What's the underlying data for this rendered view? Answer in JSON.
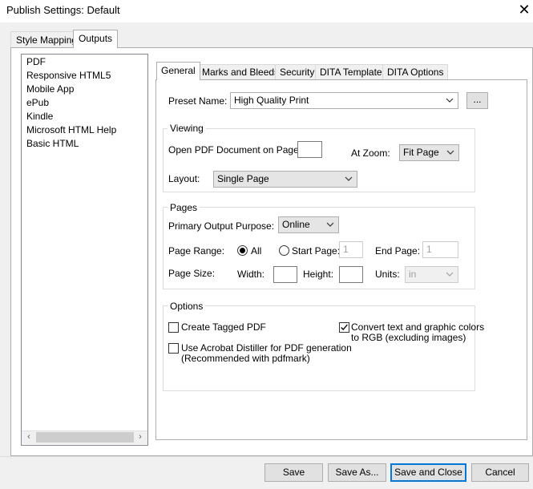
{
  "window": {
    "title": "Publish Settings: Default",
    "close_glyph": "✕"
  },
  "outer_tabs": [
    "Style Mapping",
    "Outputs"
  ],
  "outputs_list": [
    "PDF",
    "Responsive HTML5",
    "Mobile App",
    "ePub",
    "Kindle",
    "Microsoft HTML Help",
    "Basic HTML"
  ],
  "inner_tabs": [
    "General",
    "Marks and Bleeds",
    "Security",
    "DITA Template",
    "DITA Options"
  ],
  "preset": {
    "label": "Preset Name:",
    "value": "High Quality Print",
    "browse": "..."
  },
  "viewing": {
    "title": "Viewing",
    "open_page_label": "Open PDF Document on Page:",
    "open_page_value": "",
    "zoom_label": "At Zoom:",
    "zoom_value": "Fit Page",
    "layout_label": "Layout:",
    "layout_value": "Single Page"
  },
  "pages": {
    "title": "Pages",
    "purpose_label": "Primary Output Purpose:",
    "purpose_value": "Online",
    "range_label": "Page Range:",
    "all_label": "All",
    "start_label": "Start Page:",
    "start_value": "1",
    "end_label": "End Page:",
    "end_value": "1",
    "size_label": "Page Size:",
    "width_label": "Width:",
    "height_label": "Height:",
    "units_label": "Units:",
    "units_value": "in"
  },
  "options": {
    "title": "Options",
    "tagged_pdf": "Create Tagged PDF",
    "distiller_line1": "Use Acrobat Distiller for PDF generation",
    "distiller_line2": "(Recommended with pdfmark)",
    "convert_line1": "Convert text and graphic colors",
    "convert_line2": "to RGB (excluding images)"
  },
  "buttons": {
    "save": "Save",
    "save_as": "Save As...",
    "save_close": "Save and Close",
    "cancel": "Cancel"
  },
  "scrollbar": {
    "left": "‹",
    "right": "›"
  }
}
